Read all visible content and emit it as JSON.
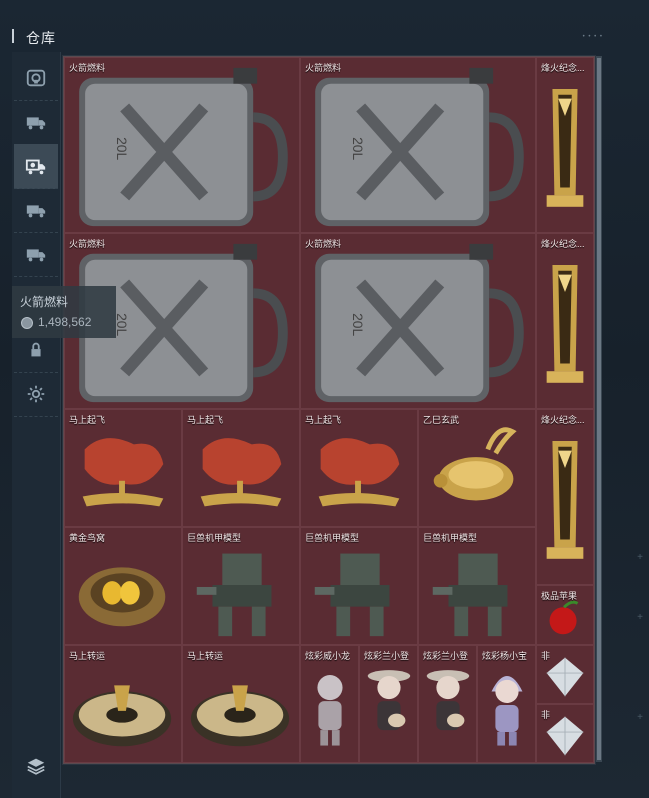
{
  "window": {
    "title": "仓库"
  },
  "tooltip": {
    "name": "火箭燃料",
    "value": "1,498,562",
    "icon": "coin-icon"
  },
  "colors": {
    "cell_bg": "#5a2c33",
    "cell_border": "#6a3b43",
    "panel_bg": "#3f2228",
    "sidebar_bg": "#1e2a36",
    "accent_active": "#3c4a56"
  },
  "sidebar": {
    "items": [
      {
        "icon": "vault-icon",
        "active": false
      },
      {
        "icon": "truck-icon",
        "active": false
      },
      {
        "icon": "truck-camera-icon",
        "active": true
      },
      {
        "icon": "truck-icon",
        "active": false
      },
      {
        "icon": "truck-icon",
        "active": false
      },
      {
        "icon": "lock-icon",
        "active": false
      },
      {
        "icon": "gear-icon",
        "active": false
      }
    ],
    "bottom_icon": "layers-icon"
  },
  "items": [
    {
      "name": "火箭燃料",
      "type": "fuel"
    },
    {
      "name": "火箭燃料",
      "type": "fuel"
    },
    {
      "name": "烽火纪念...",
      "type": "trophy"
    },
    {
      "name": "火箭燃料",
      "type": "fuel"
    },
    {
      "name": "火箭燃料",
      "type": "fuel"
    },
    {
      "name": "烽火纪念...",
      "type": "trophy"
    },
    {
      "name": "马上起飞",
      "type": "horse"
    },
    {
      "name": "马上起飞",
      "type": "horse"
    },
    {
      "name": "马上起飞",
      "type": "horse"
    },
    {
      "name": "乙巳玄武",
      "type": "turtle"
    },
    {
      "name": "烽火纪念...",
      "type": "trophy"
    },
    {
      "name": "黄金鸟窝",
      "type": "nest"
    },
    {
      "name": "巨兽机甲模型",
      "type": "mech"
    },
    {
      "name": "巨兽机甲模型",
      "type": "mech"
    },
    {
      "name": "巨兽机甲模型",
      "type": "mech"
    },
    {
      "name": "极品苹果",
      "type": "apple"
    },
    {
      "name": "马上转运",
      "type": "wheel"
    },
    {
      "name": "马上转运",
      "type": "wheel"
    },
    {
      "name": "炫彩威小龙",
      "type": "doll"
    },
    {
      "name": "炫彩兰小登",
      "type": "doll_guitar"
    },
    {
      "name": "炫彩兰小登",
      "type": "doll_guitar"
    },
    {
      "name": "炫彩杨小宝",
      "type": "doll_hood"
    },
    {
      "name": "非",
      "type": "diamond"
    },
    {
      "name": "非",
      "type": "diamond"
    }
  ]
}
